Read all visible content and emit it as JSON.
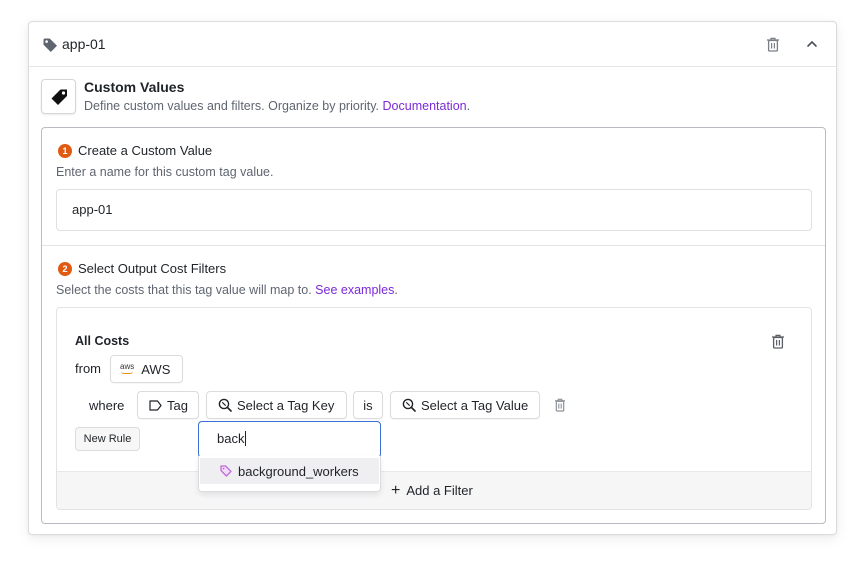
{
  "header": {
    "title": "app-01"
  },
  "intro": {
    "title": "Custom Values",
    "description": "Define custom values and filters. Organize by priority.",
    "doc_link": "Documentation",
    "doc_suffix": "."
  },
  "step1": {
    "number": "1",
    "title": "Create a Custom Value",
    "subtitle": "Enter a name for this custom tag value.",
    "name_value": "app-01"
  },
  "step2": {
    "number": "2",
    "title": "Select Output Cost Filters",
    "subtitle": "Select the costs that this tag value will map to.",
    "examples_link": "See examples",
    "examples_suffix": "."
  },
  "filter": {
    "heading": "All Costs",
    "from_label": "from",
    "provider": "AWS",
    "provider_logo_text": "aws",
    "where_label": "where",
    "tag_label": "Tag",
    "tag_key_placeholder": "Select a Tag Key",
    "operator": "is",
    "tag_value_placeholder": "Select a Tag Value",
    "new_rule": "New Rule",
    "add_filter": "Add a Filter",
    "add_symbol": "+"
  },
  "search": {
    "value": "back",
    "options": [
      "background_workers"
    ]
  },
  "colors": {
    "accent_link": "#7b2ad6",
    "step_badge": "#e05a12",
    "focus_border": "#3b6fd6",
    "option_icon": "#c06ad6"
  },
  "icons": [
    "tag-icon",
    "trash-icon",
    "chevron-up-icon",
    "price-tag-icon",
    "aws-logo",
    "tag-outline-icon",
    "tag-search-icon",
    "plus-icon"
  ]
}
